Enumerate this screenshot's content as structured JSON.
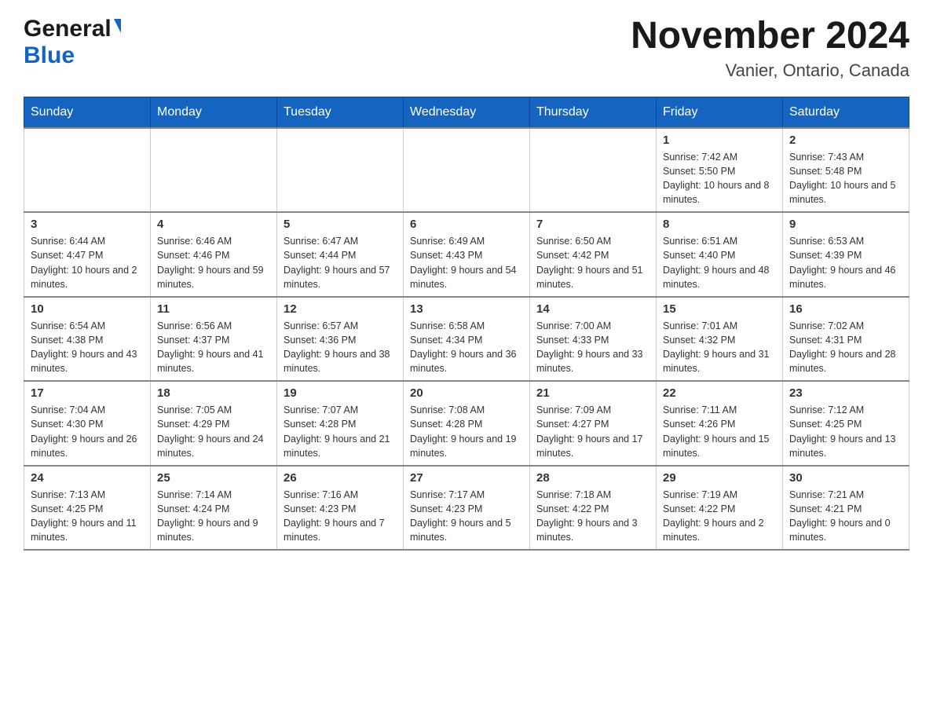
{
  "header": {
    "logo_general": "General",
    "logo_blue": "Blue",
    "month_year": "November 2024",
    "location": "Vanier, Ontario, Canada"
  },
  "calendar": {
    "days_of_week": [
      "Sunday",
      "Monday",
      "Tuesday",
      "Wednesday",
      "Thursday",
      "Friday",
      "Saturday"
    ],
    "weeks": [
      [
        {
          "day": "",
          "info": ""
        },
        {
          "day": "",
          "info": ""
        },
        {
          "day": "",
          "info": ""
        },
        {
          "day": "",
          "info": ""
        },
        {
          "day": "",
          "info": ""
        },
        {
          "day": "1",
          "info": "Sunrise: 7:42 AM\nSunset: 5:50 PM\nDaylight: 10 hours and 8 minutes."
        },
        {
          "day": "2",
          "info": "Sunrise: 7:43 AM\nSunset: 5:48 PM\nDaylight: 10 hours and 5 minutes."
        }
      ],
      [
        {
          "day": "3",
          "info": "Sunrise: 6:44 AM\nSunset: 4:47 PM\nDaylight: 10 hours and 2 minutes."
        },
        {
          "day": "4",
          "info": "Sunrise: 6:46 AM\nSunset: 4:46 PM\nDaylight: 9 hours and 59 minutes."
        },
        {
          "day": "5",
          "info": "Sunrise: 6:47 AM\nSunset: 4:44 PM\nDaylight: 9 hours and 57 minutes."
        },
        {
          "day": "6",
          "info": "Sunrise: 6:49 AM\nSunset: 4:43 PM\nDaylight: 9 hours and 54 minutes."
        },
        {
          "day": "7",
          "info": "Sunrise: 6:50 AM\nSunset: 4:42 PM\nDaylight: 9 hours and 51 minutes."
        },
        {
          "day": "8",
          "info": "Sunrise: 6:51 AM\nSunset: 4:40 PM\nDaylight: 9 hours and 48 minutes."
        },
        {
          "day": "9",
          "info": "Sunrise: 6:53 AM\nSunset: 4:39 PM\nDaylight: 9 hours and 46 minutes."
        }
      ],
      [
        {
          "day": "10",
          "info": "Sunrise: 6:54 AM\nSunset: 4:38 PM\nDaylight: 9 hours and 43 minutes."
        },
        {
          "day": "11",
          "info": "Sunrise: 6:56 AM\nSunset: 4:37 PM\nDaylight: 9 hours and 41 minutes."
        },
        {
          "day": "12",
          "info": "Sunrise: 6:57 AM\nSunset: 4:36 PM\nDaylight: 9 hours and 38 minutes."
        },
        {
          "day": "13",
          "info": "Sunrise: 6:58 AM\nSunset: 4:34 PM\nDaylight: 9 hours and 36 minutes."
        },
        {
          "day": "14",
          "info": "Sunrise: 7:00 AM\nSunset: 4:33 PM\nDaylight: 9 hours and 33 minutes."
        },
        {
          "day": "15",
          "info": "Sunrise: 7:01 AM\nSunset: 4:32 PM\nDaylight: 9 hours and 31 minutes."
        },
        {
          "day": "16",
          "info": "Sunrise: 7:02 AM\nSunset: 4:31 PM\nDaylight: 9 hours and 28 minutes."
        }
      ],
      [
        {
          "day": "17",
          "info": "Sunrise: 7:04 AM\nSunset: 4:30 PM\nDaylight: 9 hours and 26 minutes."
        },
        {
          "day": "18",
          "info": "Sunrise: 7:05 AM\nSunset: 4:29 PM\nDaylight: 9 hours and 24 minutes."
        },
        {
          "day": "19",
          "info": "Sunrise: 7:07 AM\nSunset: 4:28 PM\nDaylight: 9 hours and 21 minutes."
        },
        {
          "day": "20",
          "info": "Sunrise: 7:08 AM\nSunset: 4:28 PM\nDaylight: 9 hours and 19 minutes."
        },
        {
          "day": "21",
          "info": "Sunrise: 7:09 AM\nSunset: 4:27 PM\nDaylight: 9 hours and 17 minutes."
        },
        {
          "day": "22",
          "info": "Sunrise: 7:11 AM\nSunset: 4:26 PM\nDaylight: 9 hours and 15 minutes."
        },
        {
          "day": "23",
          "info": "Sunrise: 7:12 AM\nSunset: 4:25 PM\nDaylight: 9 hours and 13 minutes."
        }
      ],
      [
        {
          "day": "24",
          "info": "Sunrise: 7:13 AM\nSunset: 4:25 PM\nDaylight: 9 hours and 11 minutes."
        },
        {
          "day": "25",
          "info": "Sunrise: 7:14 AM\nSunset: 4:24 PM\nDaylight: 9 hours and 9 minutes."
        },
        {
          "day": "26",
          "info": "Sunrise: 7:16 AM\nSunset: 4:23 PM\nDaylight: 9 hours and 7 minutes."
        },
        {
          "day": "27",
          "info": "Sunrise: 7:17 AM\nSunset: 4:23 PM\nDaylight: 9 hours and 5 minutes."
        },
        {
          "day": "28",
          "info": "Sunrise: 7:18 AM\nSunset: 4:22 PM\nDaylight: 9 hours and 3 minutes."
        },
        {
          "day": "29",
          "info": "Sunrise: 7:19 AM\nSunset: 4:22 PM\nDaylight: 9 hours and 2 minutes."
        },
        {
          "day": "30",
          "info": "Sunrise: 7:21 AM\nSunset: 4:21 PM\nDaylight: 9 hours and 0 minutes."
        }
      ]
    ]
  }
}
